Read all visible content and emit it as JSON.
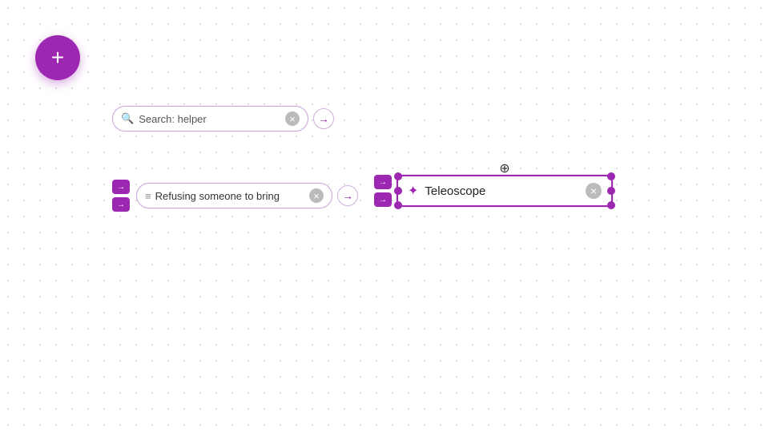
{
  "canvas": {
    "background": "#ffffff"
  },
  "fab": {
    "label": "+",
    "color": "#9c27b0"
  },
  "search_node": {
    "icon": "🔍",
    "placeholder": "Search: helper",
    "value": "Search: helper",
    "clear_label": "×",
    "arrow_label": "→"
  },
  "refusing_node": {
    "icon": "≡",
    "text": "Refusing someone to bring",
    "clear_label": "×",
    "arrow_top": "→",
    "arrow_bottom": "→"
  },
  "teleoscope_node": {
    "icon": "✦",
    "label": "Teleoscope",
    "clear_label": "×",
    "move_icon": "⊕",
    "arrow_top": "→",
    "arrow_bottom": "→"
  }
}
